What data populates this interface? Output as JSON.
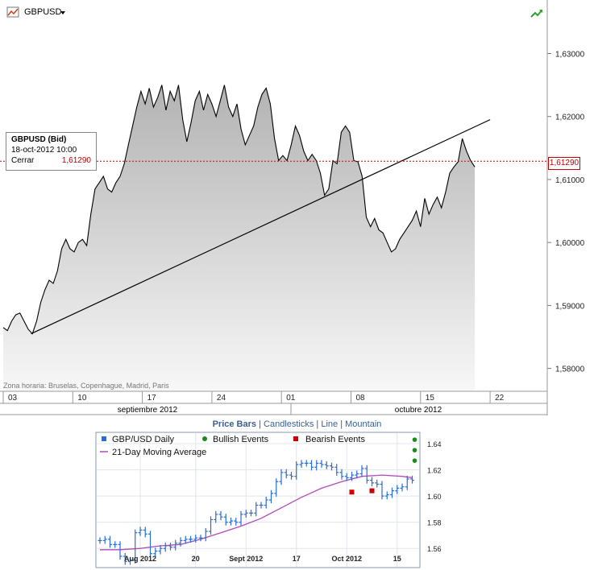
{
  "header": {
    "symbol": "GBPUSD"
  },
  "info_box": {
    "title": "GBPUSD (Bid)",
    "datetime": "18-oct-2012 10:00",
    "close_label": "Cerrar",
    "close_value": "1,61290"
  },
  "price_marker": "1,61290",
  "timezone_note": "Zona horaria: Bruselas, Copenhague, Madrid, Paris",
  "month_labels": [
    "septiembre 2012",
    "octubre 2012"
  ],
  "chart_data": [
    {
      "type": "area",
      "y_ticks": [
        "1,63000",
        "1,62000",
        "1,61000",
        "1,60000",
        "1,59000",
        "1,58000"
      ],
      "ylim": [
        1.5765,
        1.6385
      ],
      "x_ticks": [
        {
          "label": "03",
          "index": 0
        },
        {
          "label": "10",
          "index": 5
        },
        {
          "label": "17",
          "index": 10
        },
        {
          "label": "24",
          "index": 15
        },
        {
          "label": "01",
          "index": 20
        },
        {
          "label": "08",
          "index": 25
        },
        {
          "label": "15",
          "index": 30
        },
        {
          "label": "22",
          "index": 35
        }
      ],
      "series": [
        {
          "points": [
            [
              0.0,
              1.5865
            ],
            [
              0.3,
              1.586
            ],
            [
              0.6,
              1.5875
            ],
            [
              0.9,
              1.5885
            ],
            [
              1.2,
              1.5888
            ],
            [
              1.5,
              1.5875
            ],
            [
              1.8,
              1.5862
            ],
            [
              2.1,
              1.5855
            ],
            [
              2.4,
              1.5875
            ],
            [
              2.7,
              1.5905
            ],
            [
              3.0,
              1.5925
            ],
            [
              3.3,
              1.594
            ],
            [
              3.6,
              1.5935
            ],
            [
              3.9,
              1.5955
            ],
            [
              4.2,
              1.599
            ],
            [
              4.5,
              1.6005
            ],
            [
              4.8,
              1.599
            ],
            [
              5.1,
              1.5985
            ],
            [
              5.4,
              1.6
            ],
            [
              5.7,
              1.6005
            ],
            [
              6.0,
              1.5995
            ],
            [
              6.3,
              1.6045
            ],
            [
              6.6,
              1.6085
            ],
            [
              6.9,
              1.6095
            ],
            [
              7.2,
              1.6105
            ],
            [
              7.5,
              1.6085
            ],
            [
              7.8,
              1.608
            ],
            [
              8.1,
              1.6095
            ],
            [
              8.4,
              1.6105
            ],
            [
              8.7,
              1.6125
            ],
            [
              9.0,
              1.6155
            ],
            [
              9.3,
              1.6185
            ],
            [
              9.6,
              1.6215
            ],
            [
              9.9,
              1.624
            ],
            [
              10.2,
              1.622
            ],
            [
              10.5,
              1.6245
            ],
            [
              10.8,
              1.6215
            ],
            [
              11.1,
              1.623
            ],
            [
              11.4,
              1.625
            ],
            [
              11.7,
              1.621
            ],
            [
              12.0,
              1.624
            ],
            [
              12.3,
              1.6225
            ],
            [
              12.6,
              1.625
            ],
            [
              12.9,
              1.6195
            ],
            [
              13.2,
              1.616
            ],
            [
              13.5,
              1.619
            ],
            [
              13.8,
              1.6225
            ],
            [
              14.1,
              1.624
            ],
            [
              14.4,
              1.621
            ],
            [
              14.7,
              1.6235
            ],
            [
              15.0,
              1.622
            ],
            [
              15.3,
              1.62
            ],
            [
              15.6,
              1.6225
            ],
            [
              15.9,
              1.625
            ],
            [
              16.2,
              1.6215
            ],
            [
              16.5,
              1.62
            ],
            [
              16.8,
              1.622
            ],
            [
              17.1,
              1.618
            ],
            [
              17.4,
              1.6155
            ],
            [
              17.7,
              1.617
            ],
            [
              18.0,
              1.6185
            ],
            [
              18.3,
              1.6215
            ],
            [
              18.6,
              1.6235
            ],
            [
              18.9,
              1.6245
            ],
            [
              19.2,
              1.622
            ],
            [
              19.5,
              1.6165
            ],
            [
              19.8,
              1.613
            ],
            [
              20.1,
              1.6138
            ],
            [
              20.4,
              1.613
            ],
            [
              20.7,
              1.6155
            ],
            [
              21.0,
              1.6185
            ],
            [
              21.3,
              1.617
            ],
            [
              21.6,
              1.6145
            ],
            [
              21.9,
              1.613
            ],
            [
              22.2,
              1.614
            ],
            [
              22.5,
              1.613
            ],
            [
              22.8,
              1.611
            ],
            [
              23.1,
              1.6075
            ],
            [
              23.4,
              1.6085
            ],
            [
              23.7,
              1.613
            ],
            [
              24.0,
              1.6125
            ],
            [
              24.3,
              1.6175
            ],
            [
              24.6,
              1.6185
            ],
            [
              24.9,
              1.6175
            ],
            [
              25.2,
              1.613
            ],
            [
              25.5,
              1.6128
            ],
            [
              25.8,
              1.6105
            ],
            [
              26.1,
              1.604
            ],
            [
              26.4,
              1.6025
            ],
            [
              26.7,
              1.6038
            ],
            [
              27.0,
              1.602
            ],
            [
              27.3,
              1.6015
            ],
            [
              27.6,
              1.6
            ],
            [
              27.9,
              1.5985
            ],
            [
              28.2,
              1.599
            ],
            [
              28.5,
              1.6005
            ],
            [
              28.8,
              1.6015
            ],
            [
              29.1,
              1.6025
            ],
            [
              29.4,
              1.6035
            ],
            [
              29.7,
              1.605
            ],
            [
              30.0,
              1.6025
            ],
            [
              30.3,
              1.607
            ],
            [
              30.6,
              1.6045
            ],
            [
              30.9,
              1.606
            ],
            [
              31.2,
              1.6072
            ],
            [
              31.5,
              1.6055
            ],
            [
              31.8,
              1.608
            ],
            [
              32.1,
              1.611
            ],
            [
              32.4,
              1.612
            ],
            [
              32.7,
              1.6128
            ],
            [
              33.0,
              1.6165
            ],
            [
              33.3,
              1.6145
            ],
            [
              33.6,
              1.613
            ],
            [
              33.9,
              1.612
            ]
          ]
        }
      ],
      "trendline": [
        [
          2.0,
          1.5855
        ],
        [
          35.0,
          1.6195
        ]
      ],
      "current_level": 1.6129
    },
    {
      "type": "candlestick",
      "title": "Price Bars",
      "tabs": [
        "Price Bars",
        "Candlesticks",
        "Line",
        "Mountain"
      ],
      "legend": [
        {
          "label": "GBP/USD Daily",
          "color": "#2b6cd6"
        },
        {
          "label": "Bullish Events",
          "color": "#1a8a1a"
        },
        {
          "label": "Bearish Events",
          "color": "#cc0000"
        },
        {
          "label": "21-Day Moving Average",
          "color": "#b24ab8"
        }
      ],
      "y_ticks": [
        1.64,
        1.62,
        1.6,
        1.58,
        1.56
      ],
      "ylim": [
        1.546,
        1.648
      ],
      "x_ticks": [
        {
          "label": "Aug 2012",
          "index": 8
        },
        {
          "label": "20",
          "index": 19
        },
        {
          "label": "Sept 2012",
          "index": 29
        },
        {
          "label": "17",
          "index": 39
        },
        {
          "label": "Oct 2012",
          "index": 49
        },
        {
          "label": "15",
          "index": 59
        }
      ],
      "closes": [
        1.566,
        1.567,
        1.563,
        1.563,
        1.554,
        1.55,
        1.551,
        1.572,
        1.574,
        1.571,
        1.556,
        1.558,
        1.56,
        1.562,
        1.561,
        1.564,
        1.566,
        1.567,
        1.567,
        1.568,
        1.568,
        1.573,
        1.582,
        1.586,
        1.584,
        1.58,
        1.581,
        1.58,
        1.586,
        1.587,
        1.587,
        1.593,
        1.593,
        1.597,
        1.602,
        1.611,
        1.618,
        1.616,
        1.615,
        1.624,
        1.625,
        1.625,
        1.622,
        1.625,
        1.624,
        1.623,
        1.622,
        1.618,
        1.615,
        1.614,
        1.616,
        1.617,
        1.621,
        1.612,
        1.61,
        1.609,
        1.6,
        1.601,
        1.604,
        1.606,
        1.607,
        1.613,
        1.612
      ],
      "ma": [
        [
          0,
          1.559
        ],
        [
          4,
          1.559
        ],
        [
          8,
          1.56
        ],
        [
          12,
          1.562
        ],
        [
          16,
          1.563
        ],
        [
          20,
          1.567
        ],
        [
          24,
          1.572
        ],
        [
          28,
          1.577
        ],
        [
          32,
          1.583
        ],
        [
          36,
          1.591
        ],
        [
          40,
          1.599
        ],
        [
          44,
          1.606
        ],
        [
          48,
          1.611
        ],
        [
          52,
          1.615
        ],
        [
          56,
          1.616
        ],
        [
          60,
          1.615
        ],
        [
          62,
          1.614
        ]
      ],
      "bullish_events": [
        [
          62,
          1.643
        ],
        [
          62,
          1.635
        ],
        [
          62,
          1.627
        ]
      ],
      "bearish_events": [
        [
          50,
          1.603
        ],
        [
          54,
          1.604
        ]
      ]
    }
  ]
}
